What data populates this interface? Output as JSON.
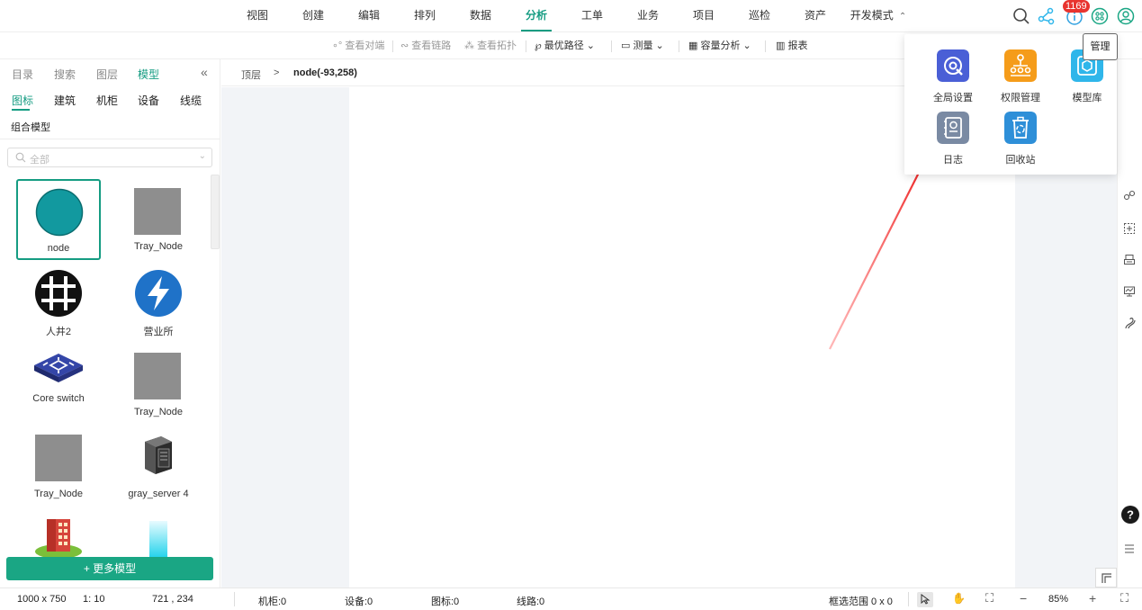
{
  "top_menu": [
    "视图",
    "创建",
    "编辑",
    "排列",
    "数据",
    "分析",
    "工单",
    "业务",
    "项目",
    "巡检",
    "资产"
  ],
  "top_menu_active": "分析",
  "dev_mode": "开发模式",
  "notification_count": "1169",
  "toolbar": {
    "view_peer": "查看对端",
    "view_link": "查看链路",
    "view_topology": "查看拓扑",
    "best_path": "最优路径",
    "measure": "测量",
    "capacity": "容量分析",
    "report": "报表"
  },
  "left_tabs": [
    "目录",
    "搜索",
    "图层",
    "模型"
  ],
  "left_tabs_active": "模型",
  "category_tabs": [
    "图标",
    "建筑",
    "机柜",
    "设备",
    "线缆"
  ],
  "category_active": "图标",
  "combo_label": "组合模型",
  "search_placeholder": "全部",
  "models": [
    "node",
    "Tray_Node",
    "人井2",
    "营业所",
    "Core switch",
    "Tray_Node",
    "Tray_Node",
    "gray_server 4"
  ],
  "more_models": "+ 更多模型",
  "breadcrumb": {
    "root": "顶层",
    "separator": ">",
    "current": "node(-93,258)"
  },
  "management_menu": {
    "tooltip": "管理",
    "items": [
      "全局设置",
      "权限管理",
      "模型库",
      "日志",
      "回收站"
    ]
  },
  "status": {
    "canvas_size": "1000 x 750",
    "scale": "1: 10",
    "coords": "721 , 234",
    "cabinet": "机柜:0",
    "device": "设备:0",
    "icon": "图标:0",
    "line": "线路:0",
    "selection": "框选范围  0 x 0",
    "zoom": "85%"
  },
  "colors": {
    "accent": "#159c82",
    "more_button": "#1aa684",
    "badge": "#e8342f",
    "global_settings": "#4a5fd6",
    "permissions": "#f59c1a",
    "model_library": "#2fb6ea",
    "log": "#7a8aa3",
    "recycle": "#2e8fd8",
    "arrow": "#ee2222"
  }
}
